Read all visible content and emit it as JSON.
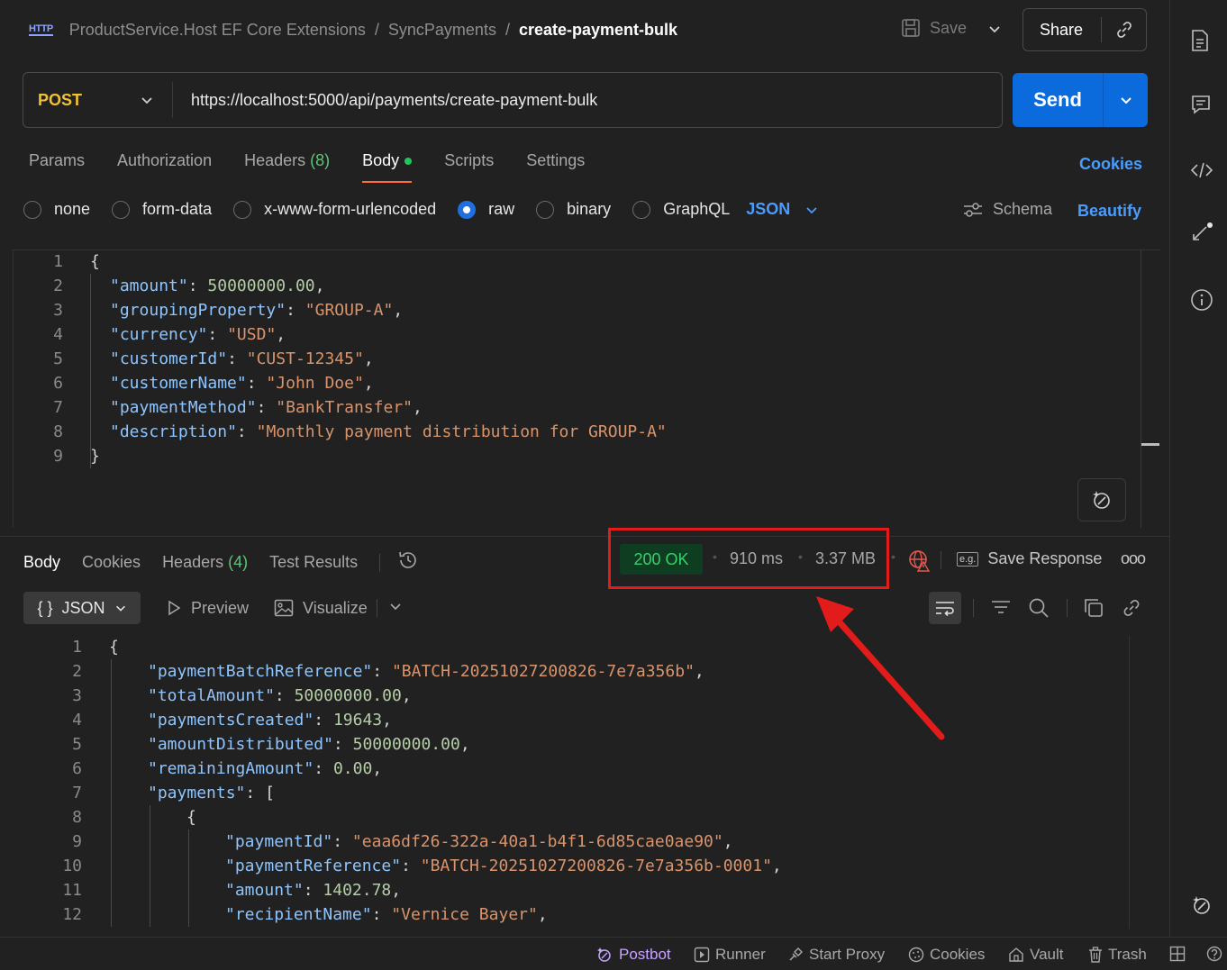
{
  "header": {
    "breadcrumb": [
      "ProductService.Host EF Core Extensions",
      "SyncPayments"
    ],
    "current": "create-payment-bulk",
    "separator": "/",
    "save_label": "Save",
    "share_label": "Share",
    "http_badge": "HTTP"
  },
  "request": {
    "method": "POST",
    "url": "https://localhost:5000/api/payments/create-payment-bulk",
    "send_label": "Send",
    "tabs": {
      "params": "Params",
      "authorization": "Authorization",
      "headers": "Headers",
      "headers_count": "(8)",
      "body": "Body",
      "scripts": "Scripts",
      "settings": "Settings"
    },
    "cookies_label": "Cookies",
    "body_types": {
      "none": "none",
      "form_data": "form-data",
      "urlencoded": "x-www-form-urlencoded",
      "raw": "raw",
      "binary": "binary",
      "graphql": "GraphQL"
    },
    "selected_body_type": "raw",
    "format": "JSON",
    "schema_label": "Schema",
    "beautify_label": "Beautify",
    "body_lines": [
      {
        "n": "1",
        "indent": 0,
        "text": "{"
      },
      {
        "n": "2",
        "indent": 1,
        "key": "amount",
        "num": "50000000.00",
        "tail": ","
      },
      {
        "n": "3",
        "indent": 1,
        "key": "groupingProperty",
        "str": "GROUP-A",
        "tail": ","
      },
      {
        "n": "4",
        "indent": 1,
        "key": "currency",
        "str": "USD",
        "tail": ","
      },
      {
        "n": "5",
        "indent": 1,
        "key": "customerId",
        "str": "CUST-12345",
        "tail": ","
      },
      {
        "n": "6",
        "indent": 1,
        "key": "customerName",
        "str": "John Doe",
        "tail": ","
      },
      {
        "n": "7",
        "indent": 1,
        "key": "paymentMethod",
        "str": "BankTransfer",
        "tail": ","
      },
      {
        "n": "8",
        "indent": 1,
        "key": "description",
        "str": "Monthly payment distribution for GROUP-A",
        "tail": ""
      },
      {
        "n": "9",
        "indent": 0,
        "text": "}"
      }
    ]
  },
  "response": {
    "tabs": {
      "body": "Body",
      "cookies": "Cookies",
      "headers": "Headers",
      "headers_count": "(4)",
      "test_results": "Test Results"
    },
    "status": "200 OK",
    "time": "910 ms",
    "size": "3.37 MB",
    "save_response_label": "Save Response",
    "eg_badge": "e.g.",
    "more_label": "ooo",
    "format": "JSON",
    "format_braces": "{ }",
    "preview_label": "Preview",
    "visualize_label": "Visualize",
    "body_lines": [
      {
        "n": "1",
        "indent": 0,
        "text": "{"
      },
      {
        "n": "2",
        "indent": 1,
        "key": "paymentBatchReference",
        "str": "BATCH-20251027200826-7e7a356b",
        "tail": ","
      },
      {
        "n": "3",
        "indent": 1,
        "key": "totalAmount",
        "num": "50000000.00",
        "tail": ","
      },
      {
        "n": "4",
        "indent": 1,
        "key": "paymentsCreated",
        "num": "19643",
        "tail": ","
      },
      {
        "n": "5",
        "indent": 1,
        "key": "amountDistributed",
        "num": "50000000.00",
        "tail": ","
      },
      {
        "n": "6",
        "indent": 1,
        "key": "remainingAmount",
        "num": "0.00",
        "tail": ","
      },
      {
        "n": "7",
        "indent": 1,
        "key": "payments",
        "raw": "[",
        "tail": ""
      },
      {
        "n": "8",
        "indent": 2,
        "text": "{"
      },
      {
        "n": "9",
        "indent": 3,
        "key": "paymentId",
        "str": "eaa6df26-322a-40a1-b4f1-6d85cae0ae90",
        "tail": ","
      },
      {
        "n": "10",
        "indent": 3,
        "key": "paymentReference",
        "str": "BATCH-20251027200826-7e7a356b-0001",
        "tail": ","
      },
      {
        "n": "11",
        "indent": 3,
        "key": "amount",
        "num": "1402.78",
        "tail": ","
      },
      {
        "n": "12",
        "indent": 3,
        "key": "recipientName",
        "str": "Vernice Bayer",
        "tail": ","
      }
    ]
  },
  "footer": {
    "postbot": "Postbot",
    "runner": "Runner",
    "start_proxy": "Start Proxy",
    "cookies": "Cookies",
    "vault": "Vault",
    "trash": "Trash"
  },
  "colors": {
    "send": "#0b6bdc",
    "method": "#f1c232",
    "status_ok": "#37d16a",
    "annotation": "#e21b1b",
    "link": "#4a9cff"
  }
}
